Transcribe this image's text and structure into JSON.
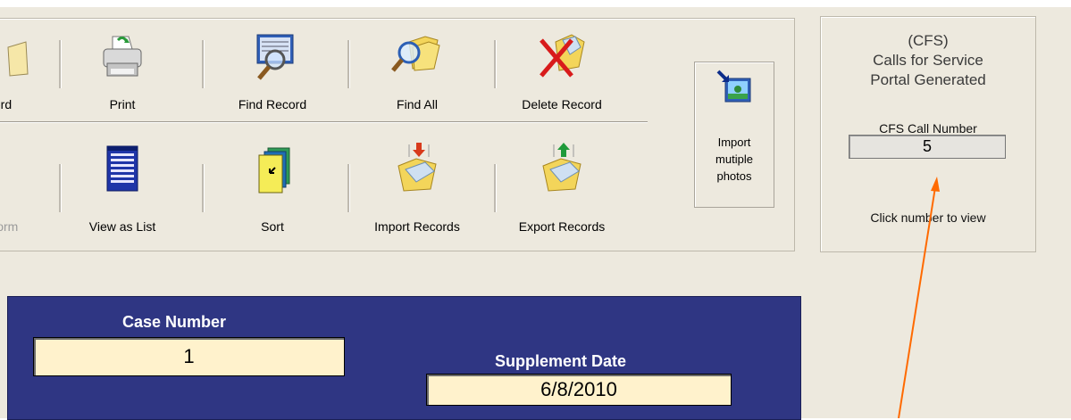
{
  "toolbar": {
    "row1": [
      {
        "label": "ord",
        "icon": "record-icon-partial"
      },
      {
        "label": "Print",
        "icon": "printer-icon"
      },
      {
        "label": "Find Record",
        "icon": "find-record-icon"
      },
      {
        "label": "Find All",
        "icon": "find-all-folder-icon"
      },
      {
        "label": "Delete Record",
        "icon": "delete-record-icon"
      }
    ],
    "row2": [
      {
        "label": "Form",
        "icon": "form-icon-partial"
      },
      {
        "label": "View as List",
        "icon": "list-view-icon"
      },
      {
        "label": "Sort",
        "icon": "sort-icon"
      },
      {
        "label": "Import Records",
        "icon": "import-records-icon"
      },
      {
        "label": "Export Records",
        "icon": "export-records-icon"
      }
    ],
    "import_photos": {
      "line1": "Import",
      "line2": "mutiple",
      "line3": "photos",
      "icon": "import-photos-icon"
    }
  },
  "cfs": {
    "line1": "(CFS)",
    "line2": "Calls for Service",
    "line3": "Portal Generated",
    "number_label": "CFS Call Number",
    "number_value": "5",
    "note": "Click number to view"
  },
  "case": {
    "case_number_label": "Case Number",
    "case_number_value": "1",
    "supplement_label": "Supplement Date",
    "supplement_value": "6/8/2010"
  },
  "colors": {
    "panel_blue": "#2f3683",
    "field_yellow": "#fff2cc",
    "arrow": "#ff6a00"
  }
}
